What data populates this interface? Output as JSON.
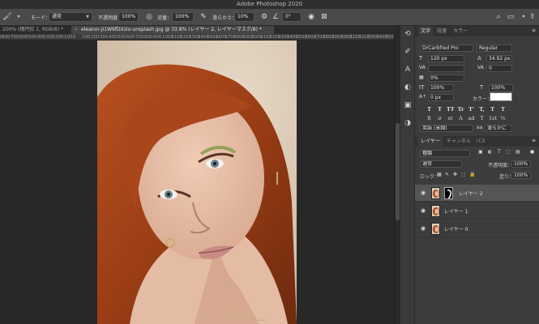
{
  "app": {
    "title": "Adobe Photoshop 2020"
  },
  "options_bar": {
    "mode_label": "モード：",
    "mode_value": "通常",
    "opacity_label": "不透明度：",
    "opacity_value": "100%",
    "flow_label": "流量：",
    "flow_value": "100%",
    "smoothing_label": "滑らかさ：",
    "smoothing_value": "10%",
    "angle_value": "0°"
  },
  "tabs": [
    {
      "label": "200% (楕円形 1, RGB/8) *",
      "active": false
    },
    {
      "label": "eleanor-Ji1W9fDXzio-unsplash.jpg @ 33.8% (レイヤー 2, レイヤーマスク/8) *",
      "active": true
    }
  ],
  "ruler": {
    "ticks": [
      "1200",
      "1100",
      "1000",
      "900",
      "800",
      "700",
      "600",
      "500",
      "400",
      "300",
      "200",
      "100",
      "0",
      "100",
      "200",
      "300",
      "400",
      "500",
      "600",
      "700",
      "800",
      "900",
      "1000",
      "1100",
      "1200",
      "1300",
      "1400",
      "1500",
      "1600",
      "1700",
      "1800",
      "1900",
      "2000",
      "2100",
      "2200",
      "2300",
      "2400",
      "2500",
      "2600",
      "2700",
      "2800",
      "2900",
      "3000",
      "3100",
      "3200",
      "3300",
      "3400",
      "3500",
      "3600",
      "3700"
    ]
  },
  "character_panel": {
    "tabs": [
      "文字",
      "段落",
      "カラー"
    ],
    "font_family": "DrCarbfred Pro",
    "font_style": "Regular",
    "font_size": "120 px",
    "leading": "34.92 px",
    "kerning": "",
    "tracking": "0",
    "tsume": "0%",
    "vertical_scale": "100%",
    "horizontal_scale": "100%",
    "baseline_shift": "0 px",
    "color_label": "カラー：",
    "text_color": "#ffffff",
    "language": "英語 (米国)",
    "antialias": "滑らかに",
    "style_buttons": [
      "T",
      "T",
      "TT",
      "Tr",
      "T'",
      "T,",
      "T",
      "T"
    ],
    "opentype_buttons": [
      "fi",
      "σ",
      "st",
      "A",
      "ad",
      "T",
      "1st",
      "½"
    ]
  },
  "layers_panel": {
    "tabs": [
      "レイヤー",
      "チャンネル",
      "パス"
    ],
    "filter_kind": "種類",
    "blend_mode": "通常",
    "opacity_label": "不透明度：",
    "opacity_value": "100%",
    "lock_label": "ロック：",
    "fill_label": "塗り：",
    "fill_value": "100%",
    "layers": [
      {
        "name": "レイヤー 2",
        "selected": true,
        "has_mask": true
      },
      {
        "name": "レイヤー 1",
        "selected": false,
        "has_mask": false
      },
      {
        "name": "レイヤー 0",
        "selected": false,
        "has_mask": false
      }
    ]
  },
  "colors": {
    "canvas_bg": "#282828",
    "panel_bg": "#3c3c3c",
    "selected_layer": "#555555",
    "hair": "#a8471c",
    "skin": "#e2b9a2",
    "backdrop": "#d9cbb8"
  }
}
